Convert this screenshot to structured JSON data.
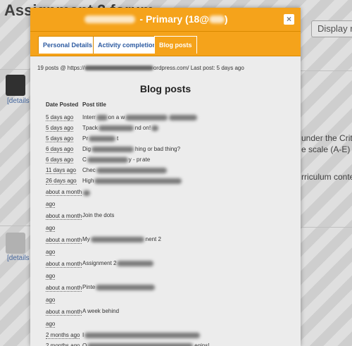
{
  "background": {
    "title": "Assignment 2 forum",
    "display_button": "Display rep",
    "details_link": "[details",
    "right_texts": [
      "under the Crite",
      "e scale (A-E) ho",
      "rriculum conter"
    ]
  },
  "modal": {
    "title_suffix": "- Primary (18@",
    "close": "×",
    "tabs": [
      "Personal Details",
      "Activity completion",
      "Blog posts"
    ],
    "active_tab": "Blog posts",
    "summary_prefix": "19 posts @ https://",
    "summary_suffix": "ordpress.com/  Last post: 5 days ago",
    "section_title": "Blog posts",
    "columns": [
      "Date Posted",
      "Post title"
    ],
    "posts": [
      {
        "date": "5 days ago",
        "title_start": "Interr",
        "title_mid": "on a w",
        "title_end": ""
      },
      {
        "date": "5 days ago",
        "title_start": "Tpack",
        "title_mid": "",
        "title_end": "nd on!"
      },
      {
        "date": "5 days ago",
        "title_start": "Pr",
        "title_mid": "",
        "title_end": "t"
      },
      {
        "date": "6 days ago",
        "title_start": "Dig",
        "title_mid": "",
        "title_end": "hing or bad thing?"
      },
      {
        "date": "6 days ago",
        "title_start": "C",
        "title_mid": "y - pr",
        "title_end": "ate"
      },
      {
        "date": "11 days ago",
        "title_start": "Chec",
        "title_mid": "",
        "title_end": ""
      },
      {
        "date": "26 days ago",
        "title_start": "High",
        "title_mid": "",
        "title_end": ""
      },
      {
        "date_line1": "about a month",
        "date_line2": "ago",
        "title_start": "",
        "title_mid": "",
        "title_end": ""
      },
      {
        "date_line1": "about a month",
        "date_line2": "ago",
        "title_start": "Join the dots",
        "title_mid": "",
        "title_end": ""
      },
      {
        "date_line1": "about a month",
        "date_line2": "ago",
        "title_start": "My",
        "title_mid": "",
        "title_end": "nent 2"
      },
      {
        "date_line1": "about a month",
        "date_line2": "ago",
        "title_start": "Assignment 2",
        "title_mid": "",
        "title_end": ""
      },
      {
        "date_line1": "about a month",
        "date_line2": "ago",
        "title_start": "Pinte",
        "title_mid": "",
        "title_end": ""
      },
      {
        "date_line1": "about a month",
        "date_line2": "ago",
        "title_start": "A week behind",
        "title_mid": "",
        "title_end": ""
      },
      {
        "date": "2 months ago",
        "title_start": "I",
        "title_mid": "",
        "title_end": ""
      },
      {
        "date": "2 months ago",
        "title_start": "O",
        "title_mid": "",
        "title_end": "egins!"
      }
    ]
  },
  "colors": {
    "header": "#f5a31b",
    "link": "#2c5aa0",
    "modal_bg": "#ececec"
  }
}
